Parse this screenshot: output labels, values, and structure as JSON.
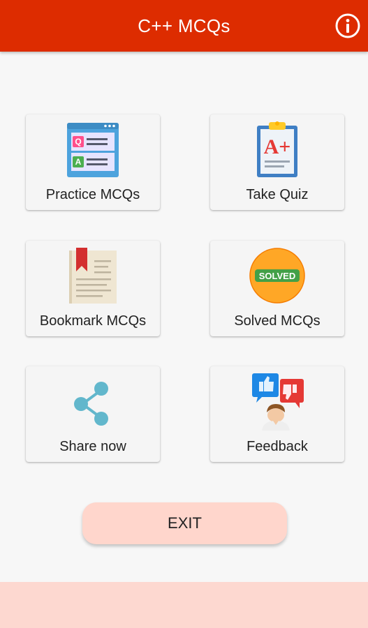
{
  "app_bar": {
    "title": "C++ MCQs",
    "info_icon": "info-circle-icon",
    "color": "#dd2c00"
  },
  "menu": {
    "items": [
      {
        "label": "Practice MCQs",
        "icon": "qa-cards-icon"
      },
      {
        "label": "Take Quiz",
        "icon": "clipboard-grade-icon"
      },
      {
        "label": "Bookmark MCQs",
        "icon": "bookmark-book-icon"
      },
      {
        "label": "Solved MCQs",
        "icon": "solved-badge-icon"
      },
      {
        "label": "Share now",
        "icon": "share-icon"
      },
      {
        "label": "Feedback",
        "icon": "feedback-icon"
      }
    ],
    "icon_text": {
      "q": "Q",
      "a": "A",
      "grade": "A+",
      "solved": "SOLVED"
    }
  },
  "exit_button": {
    "label": "EXIT",
    "color": "#ffd6cc"
  },
  "footer_color": "#fdd8d0"
}
